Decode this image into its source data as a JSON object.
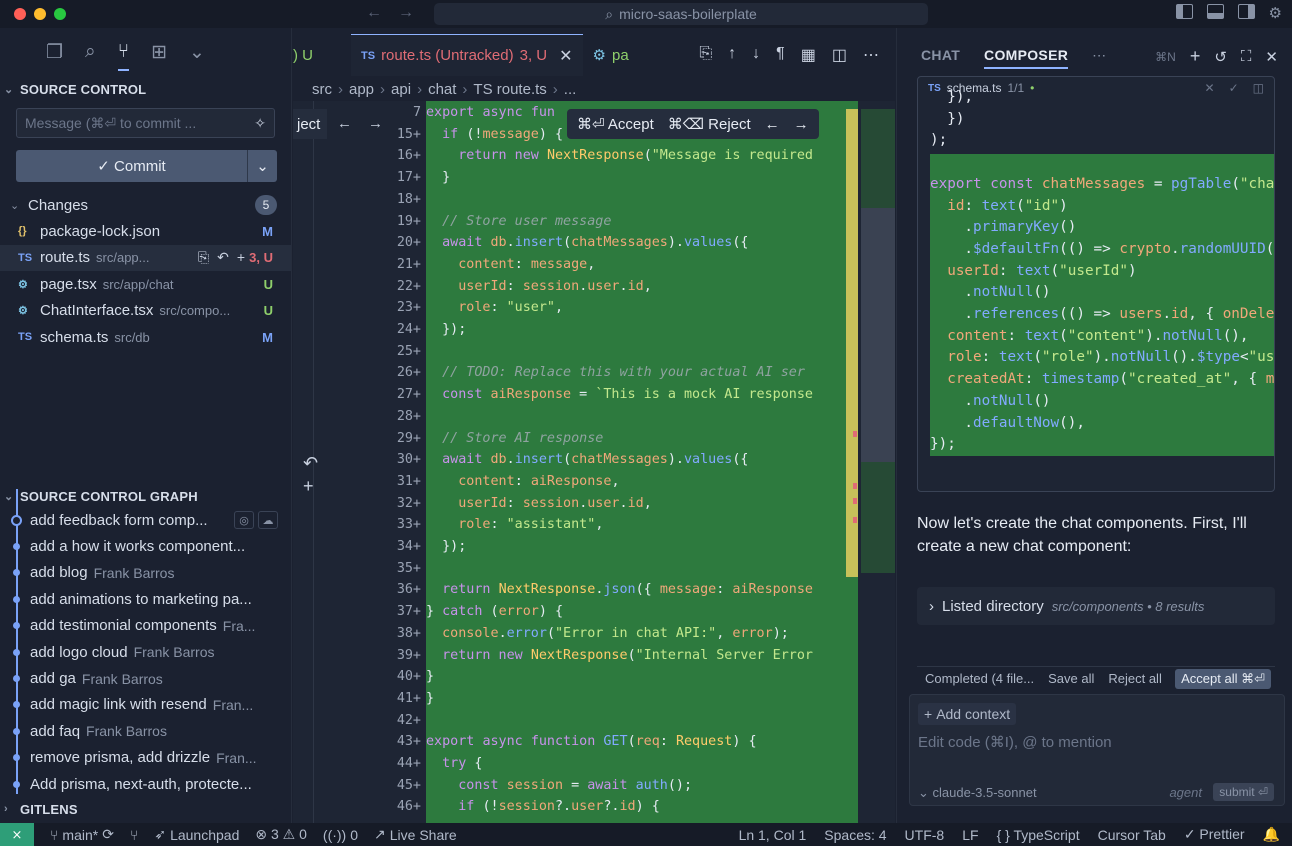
{
  "titlebar": {
    "search": "micro-saas-boilerplate"
  },
  "sidebar": {
    "source_control_title": "SOURCE CONTROL",
    "message_placeholder": "Message (⌘⏎ to commit ...",
    "commit_label": "✓ Commit",
    "changes_label": "Changes",
    "changes_count": "5",
    "files": [
      {
        "icon": "{}",
        "name": "package-lock.json",
        "path": "",
        "status": "M"
      },
      {
        "icon": "TS",
        "name": "route.ts",
        "path": "src/app...",
        "status": "3, U"
      },
      {
        "icon": "⚙",
        "name": "page.tsx",
        "path": "src/app/chat",
        "status": "U"
      },
      {
        "icon": "⚙",
        "name": "ChatInterface.tsx",
        "path": "src/compo...",
        "status": "U"
      },
      {
        "icon": "TS",
        "name": "schema.ts",
        "path": "src/db",
        "status": "M"
      }
    ],
    "graph_title": "SOURCE CONTROL GRAPH",
    "graph": [
      {
        "msg": "add feedback form comp...",
        "author": ""
      },
      {
        "msg": "add a how it works component...",
        "author": ""
      },
      {
        "msg": "add blog",
        "author": "Frank Barros"
      },
      {
        "msg": "add animations to marketing pa...",
        "author": ""
      },
      {
        "msg": "add testimonial components",
        "author": "Fra..."
      },
      {
        "msg": "add logo cloud",
        "author": "Frank Barros"
      },
      {
        "msg": "add ga",
        "author": "Frank Barros"
      },
      {
        "msg": "add magic link with resend",
        "author": "Fran..."
      },
      {
        "msg": "add faq",
        "author": "Frank Barros"
      },
      {
        "msg": "remove prisma, add drizzle",
        "author": "Fran..."
      },
      {
        "msg": "Add prisma, next-auth, protecte...",
        "author": ""
      }
    ],
    "gitlens_title": "GITLENS"
  },
  "editor": {
    "tab_prev": ") U",
    "tab_active_icon": "TS",
    "tab_active": "route.ts (Untracked)",
    "tab_active_status": "3, U",
    "tab_next": "pa",
    "breadcrumb": [
      "src",
      "app",
      "api",
      "chat",
      "TS route.ts",
      "..."
    ],
    "accept_label": "⌘⏎ Accept",
    "reject_label": "⌘⌫ Reject",
    "reject_frag": "ject",
    "line_numbers": [
      "7",
      "15+",
      "16+",
      "17+",
      "18+",
      "19+",
      "20+",
      "21+",
      "22+",
      "23+",
      "24+",
      "25+",
      "26+",
      "27+",
      "28+",
      "29+",
      "30+",
      "31+",
      "32+",
      "33+",
      "34+",
      "35+",
      "36+",
      "37+",
      "38+",
      "39+",
      "40+",
      "41+",
      "42+",
      "43+",
      "44+",
      "45+",
      "46+"
    ]
  },
  "composer": {
    "tab_chat": "CHAT",
    "tab_composer": "COMPOSER",
    "shortcut": "⌘N",
    "file_name": "schema.ts",
    "file_count": "1/1",
    "message": "Now let's create the chat components. First, I'll create a new chat component:",
    "listed_label": "Listed directory",
    "listed_sub": "src/components • 8 results",
    "completed": "Completed (4 file...",
    "save_all": "Save all",
    "reject_all": "Reject all",
    "accept_all": "Accept all ⌘⏎",
    "add_context": "Add context",
    "input_placeholder": "Edit code (⌘I), @ to mention",
    "model": "claude-3.5-sonnet",
    "mode": "agent",
    "submit": "submit ⏎"
  },
  "statusbar": {
    "branch": "main*",
    "launchpad": "Launchpad",
    "problems": "⊗ 3 ⚠ 0",
    "ports": "0",
    "live_share": "Live Share",
    "position": "Ln 1, Col 1",
    "spaces": "Spaces: 4",
    "encoding": "UTF-8",
    "eol": "LF",
    "language": "TypeScript",
    "cursor_tab": "Cursor Tab",
    "prettier": "✓ Prettier"
  }
}
